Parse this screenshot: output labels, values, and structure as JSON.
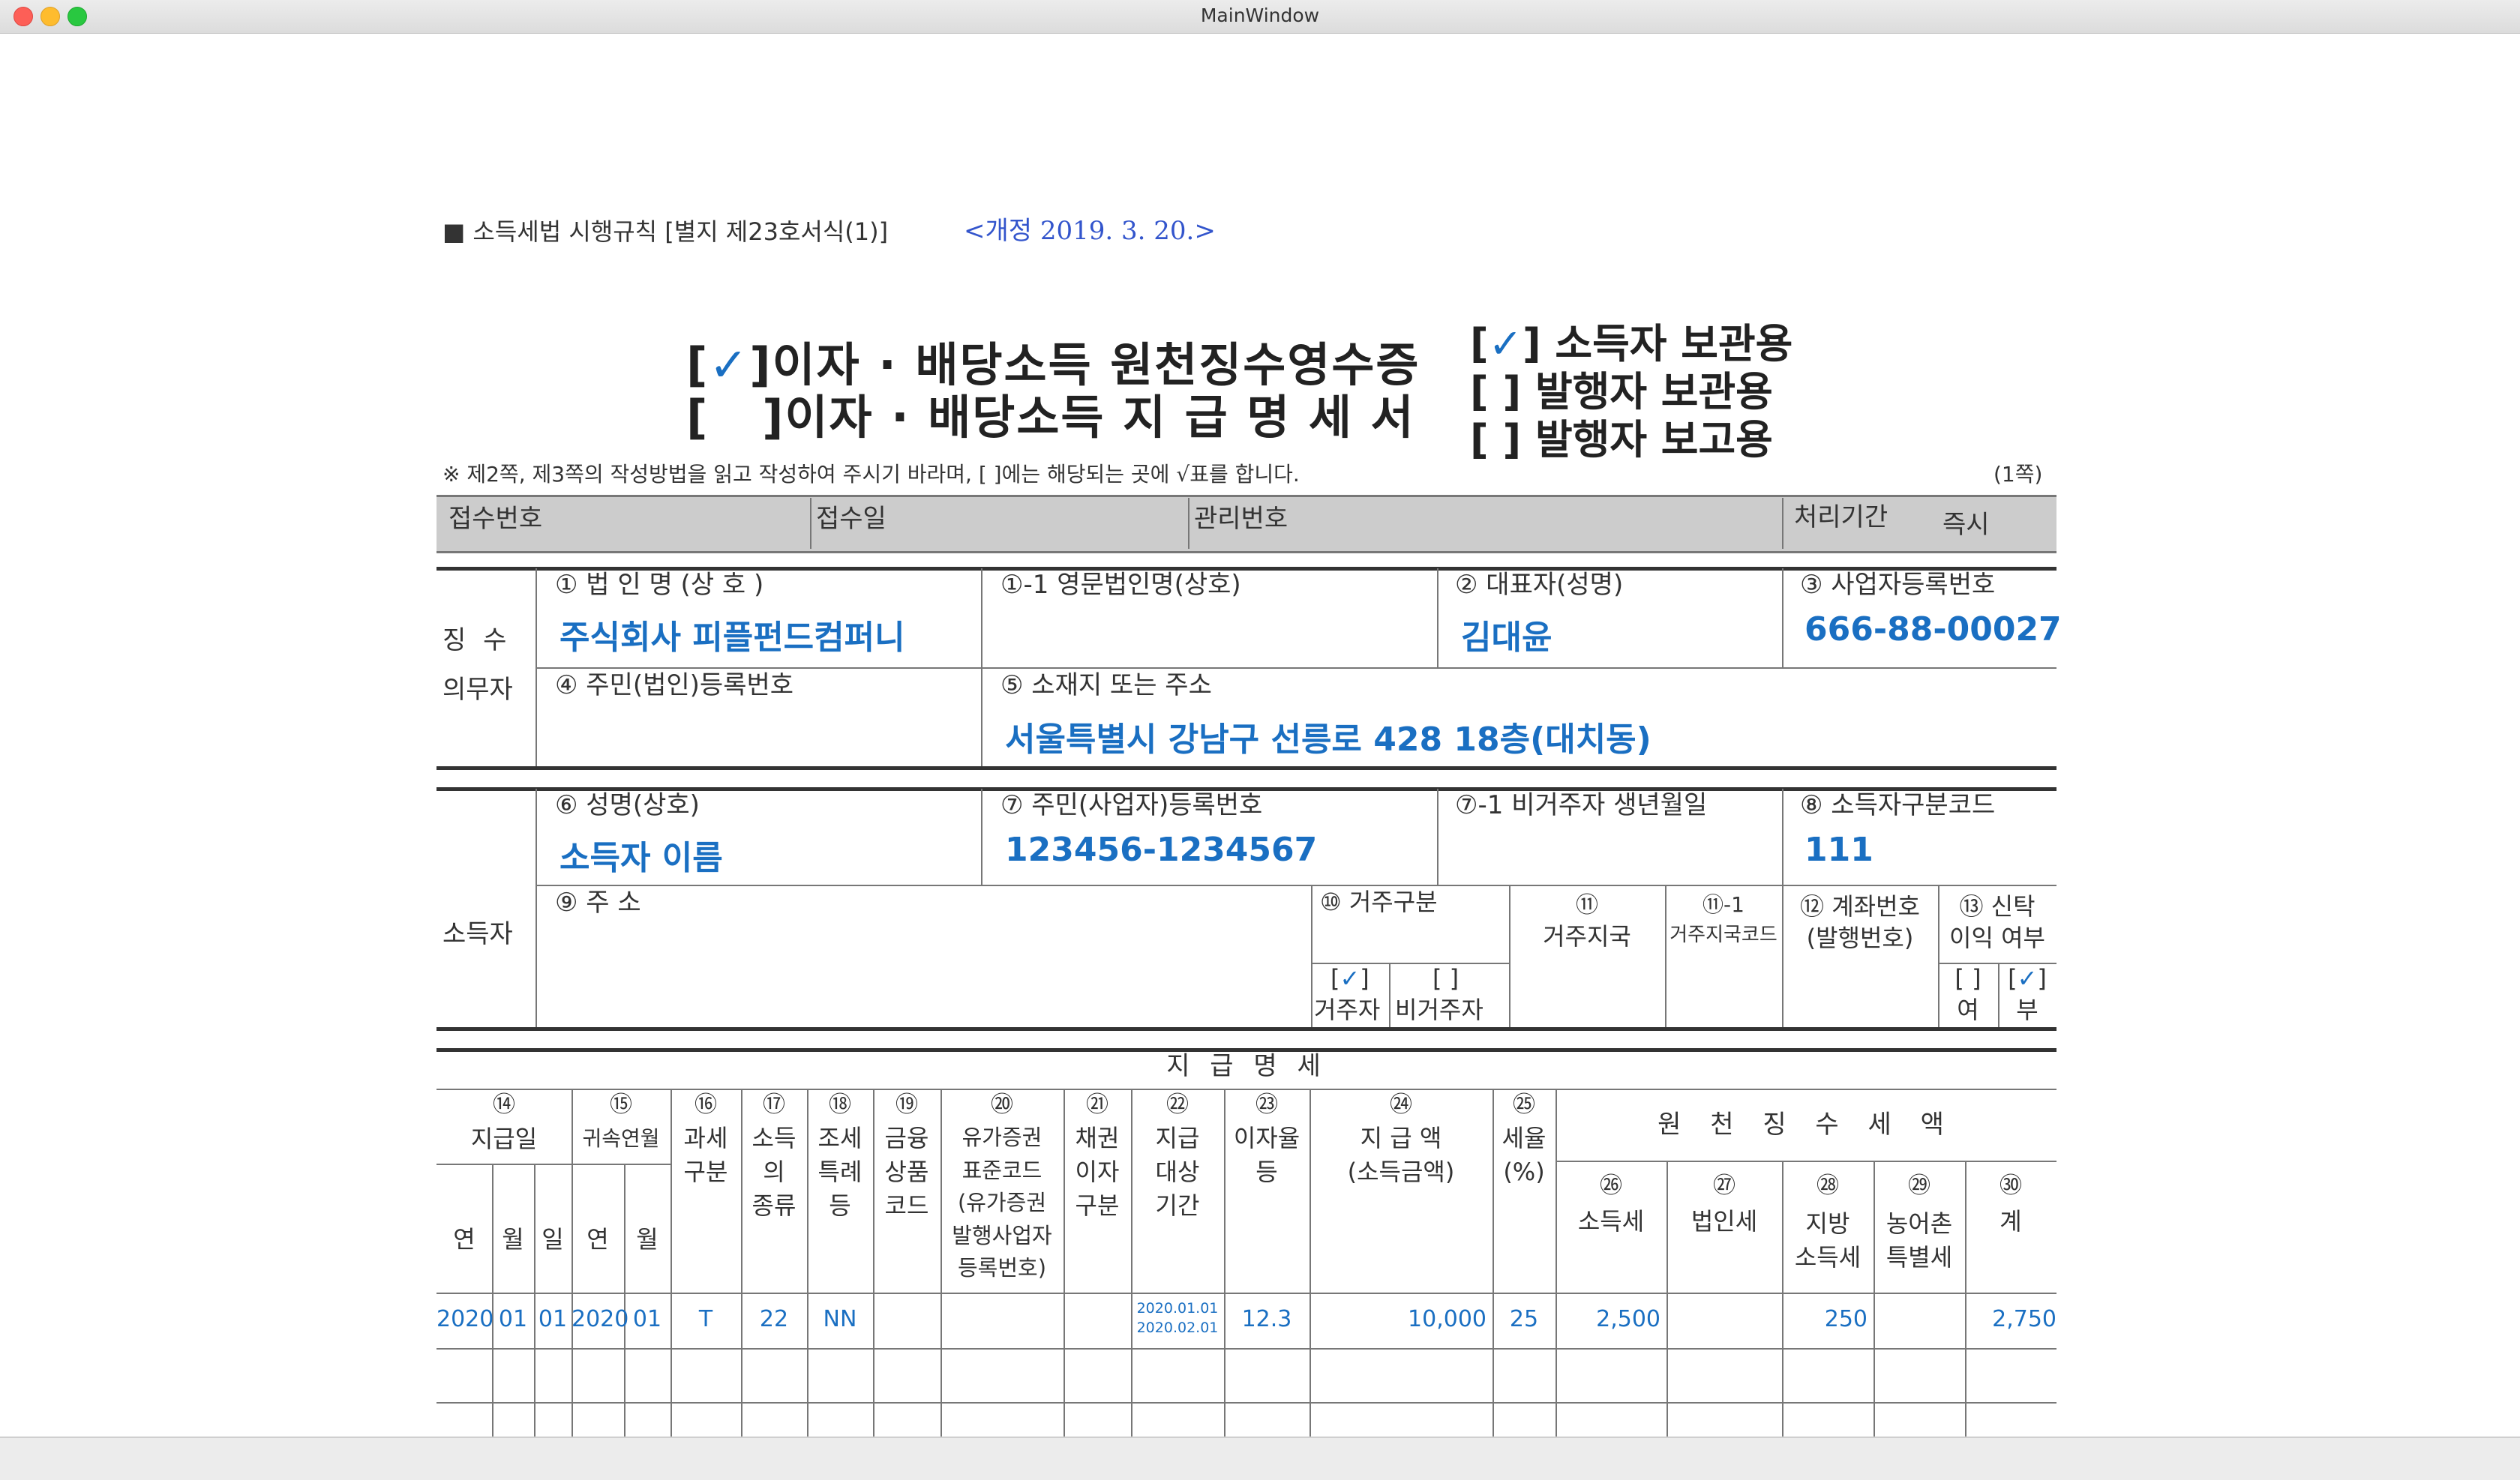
{
  "window": {
    "title": "MainWindow"
  },
  "header": {
    "regulation": "■ 소득세법 시행규칙 [별지 제23호서식(1)]",
    "revision": "<개정 2019. 3. 20.>"
  },
  "title": {
    "line1_check": "✓",
    "line1": "이자 · 배당소득 원천징수영수증",
    "line2": "이자 · 배당소득 지 급 명 세 서",
    "copy1_check": "✓",
    "copy1": "소득자 보관용",
    "copy2": "발행자 보관용",
    "copy3": "발행자 보고용"
  },
  "note": "※ 제2쪽, 제3쪽의 작성방법을 읽고 작성하여 주시기 바라며, [ ]에는 해당되는 곳에 √표를 합니다.",
  "page_label": "(1쪽)",
  "receipt_bar": {
    "receipt_no": "접수번호",
    "receipt_date": "접수일",
    "mgmt_no": "관리번호",
    "period_label": "처리기간",
    "period_value": "즉시"
  },
  "payer": {
    "section_label_1": "징 수",
    "section_label_2": "의무자",
    "corp_name_label": "① 법 인 명 (상 호 )",
    "corp_name": "주식회사 피플펀드컴퍼니",
    "eng_name_label": "①-1 영문법인명(상호)",
    "rep_label": "② 대표자(성명)",
    "rep": "김대윤",
    "bizno_label": "③ 사업자등록번호",
    "bizno": "666-88-00027",
    "resno_label": "④ 주민(법인)등록번호",
    "addr_label": "⑤ 소재지 또는 주소",
    "addr": "서울특별시 강남구 선릉로 428 18층(대치동)"
  },
  "earner": {
    "section_label": "소득자",
    "name_label": "⑥ 성명(상호)",
    "name": "소득자 이름",
    "resno_label": "⑦ 주민(사업자)등록번호",
    "resno": "123456-1234567",
    "birth_label": "⑦-1 비거주자 생년월일",
    "code_label": "⑧ 소득자구분코드",
    "code": "111",
    "addr_label": "⑨ 주 소",
    "residency_label": "⑩ 거주구분",
    "resident_check": "✓",
    "resident": "거주자",
    "nonresident": "비거주자",
    "country_label_1": "⑪",
    "country_label_2": "거주지국",
    "country_code_label_1": "⑪-1",
    "country_code_label_2": "거주지국코드",
    "account_label_1": "⑫ 계좌번호",
    "account_label_2": "(발행번호)",
    "trust_label_1": "⑬ 신탁",
    "trust_label_2": "이익 여부",
    "trust_yes": "여",
    "trust_no_check": "✓",
    "trust_no": "부"
  },
  "payment": {
    "title": "지 급 명 세",
    "col14_num": "⑭",
    "col14": "지급일",
    "col15_num": "⑮",
    "col15": "귀속연월",
    "col16_num": "⑯",
    "col16": "과세\n구분",
    "col17_num": "⑰",
    "col17": "소득\n의\n종류",
    "col18_num": "⑱",
    "col18": "조세\n특례\n등",
    "col19_num": "⑲",
    "col19": "금융\n상품\n코드",
    "col20_num": "⑳",
    "col20": "유가증권\n표준코드\n(유가증권\n발행사업자\n등록번호)",
    "col21_num": "㉑",
    "col21": "채권\n이자\n구분",
    "col22_num": "㉒",
    "col22": "지급\n대상\n기간",
    "col23_num": "㉓",
    "col23": "이자율\n등",
    "col24_num": "㉔",
    "col24": "지 급 액\n(소득금액)",
    "col25_num": "㉕",
    "col25": "세율\n(%)",
    "withholding": "원 천 징 수 세 액",
    "col26_num": "㉖",
    "col26": "소득세",
    "col27_num": "㉗",
    "col27": "법인세",
    "col28_num": "㉘",
    "col28": "지방\n소득세",
    "col29_num": "㉙",
    "col29": "농어촌\n특별세",
    "col30_num": "㉚",
    "col30": "계",
    "sub_year": "연",
    "sub_month": "월",
    "sub_day": "일",
    "sub_year2": "연",
    "sub_month2": "월",
    "row": {
      "pay_year": "2020",
      "pay_month": "01",
      "pay_day": "01",
      "att_year": "2020",
      "att_month": "01",
      "tax_type": "T",
      "income_type": "22",
      "special": "NN",
      "period_from": "2020.01.01",
      "period_to": "2020.02.01",
      "rate": "12.3",
      "amount": "10,000",
      "tax_rate": "25",
      "income_tax": "2,500",
      "local_tax": "250",
      "total": "2,750"
    }
  }
}
